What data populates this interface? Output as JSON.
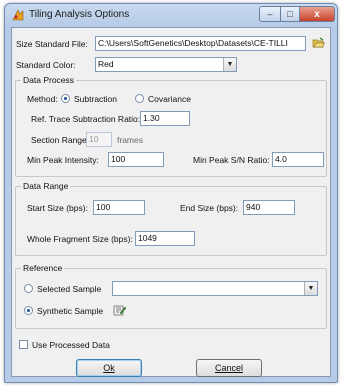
{
  "window": {
    "title": "Tiling Analysis Options",
    "controls": {
      "minimize": "–",
      "maximize": "□",
      "close": "x"
    }
  },
  "size_standard": {
    "label": "Size Standard File:",
    "value": "C:\\Users\\SoftGenetics\\Desktop\\Datasets\\CE-TILLI",
    "browse_icon": "folder-open-icon"
  },
  "standard_color": {
    "label": "Standard Color:",
    "value": "Red"
  },
  "data_process": {
    "legend": "Data Process",
    "method_label": "Method:",
    "method_options": [
      "Subtraction",
      "Covariance"
    ],
    "method_selected": "Subtraction",
    "ref_trace_label": "Ref. Trace Subtraction Ratio:",
    "ref_trace_value": "1.30",
    "section_range_label": "Section Range:",
    "section_range_value": "10",
    "section_range_unit": "frames",
    "min_peak_intensity_label": "Min Peak Intensity:",
    "min_peak_intensity_value": "100",
    "min_peak_sn_label": "Min Peak S/N Ratio:",
    "min_peak_sn_value": "4.0"
  },
  "data_range": {
    "legend": "Data Range",
    "start_label": "Start Size (bps):",
    "start_value": "100",
    "end_label": "End Size (bps):",
    "end_value": "940",
    "whole_label": "Whole Fragment Size (bps):",
    "whole_value": "1049"
  },
  "reference": {
    "legend": "Reference",
    "selected_label": "Selected Sample",
    "selected_value": "",
    "synthetic_label": "Synthetic Sample",
    "selected_option": "Synthetic Sample",
    "synthetic_icon": "edit-sample-icon"
  },
  "use_processed": {
    "label": "Use Processed Data",
    "checked": false
  },
  "buttons": {
    "ok": "Ok",
    "cancel": "Cancel"
  },
  "colors": {
    "titlebar": "#b5cbe7",
    "close": "#c7432b",
    "panel": "#f0f0f0"
  }
}
